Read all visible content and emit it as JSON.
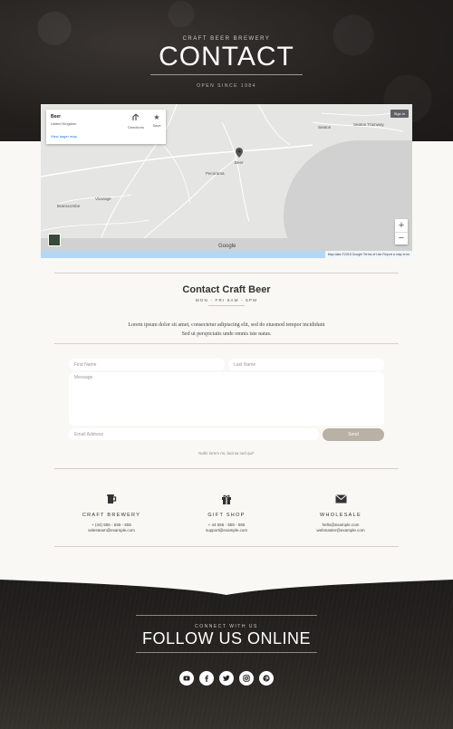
{
  "hero": {
    "eyebrow": "CRAFT BEER BREWERY",
    "title": "CONTACT",
    "subtitle": "OPEN SINCE 1984"
  },
  "map": {
    "place_name": "Beer",
    "place_country": "United Kingdom",
    "view_larger": "View larger map",
    "directions_label": "Directions",
    "save_label": "Save",
    "sign_in": "Sign in",
    "zoom_in": "+",
    "zoom_out": "−",
    "google": "Google",
    "attribution": "Map data ©2018 Google   Terms of Use   Report a map error",
    "labels": {
      "seaton": "Seaton",
      "seaton_tramway": "Seaton Tramway",
      "beer": "Beer",
      "pecorama": "Pecorama",
      "vicarage": "Vicarage",
      "branscombe": "Branscombe"
    }
  },
  "contact": {
    "title": "Contact Craft Beer",
    "hours": "MON - FRI 8AM - 5PM",
    "description": "Lorem ipsum dolor sit amet, consectetur adipiscing elit, sed do eiusmod tempor incididunt Sed ut perspiciatis unde omnis iste natus."
  },
  "form": {
    "first_name_placeholder": "First Name",
    "last_name_placeholder": "Last Name",
    "message_placeholder": "Message",
    "email_placeholder": "Email Address",
    "send_label": "Send",
    "note": "Nullo lorem mi, lacinia sed qui*"
  },
  "info": [
    {
      "name": "CRAFT BREWERY",
      "line1": "+ (44) 555 - 555 - 555",
      "line2": "salesteam@example.com",
      "icon": "beer-mug-icon"
    },
    {
      "name": "GIFT SHOP",
      "line1": "+ 44 555 - 555 - 555",
      "line2": "support@example.com",
      "icon": "gift-icon"
    },
    {
      "name": "WHOLESALE",
      "line1": "hello@example.com",
      "line2": "webmaster@example.com",
      "icon": "envelope-icon"
    }
  ],
  "footer": {
    "eyebrow": "CONNECT WITH US",
    "title": "FOLLOW US ONLINE",
    "social": [
      "youtube-icon",
      "facebook-icon",
      "twitter-icon",
      "instagram-icon",
      "pinterest-icon"
    ]
  },
  "colors": {
    "dark": "#221f1d",
    "cream": "#faf8f4",
    "accent": "#b8b1a4"
  }
}
